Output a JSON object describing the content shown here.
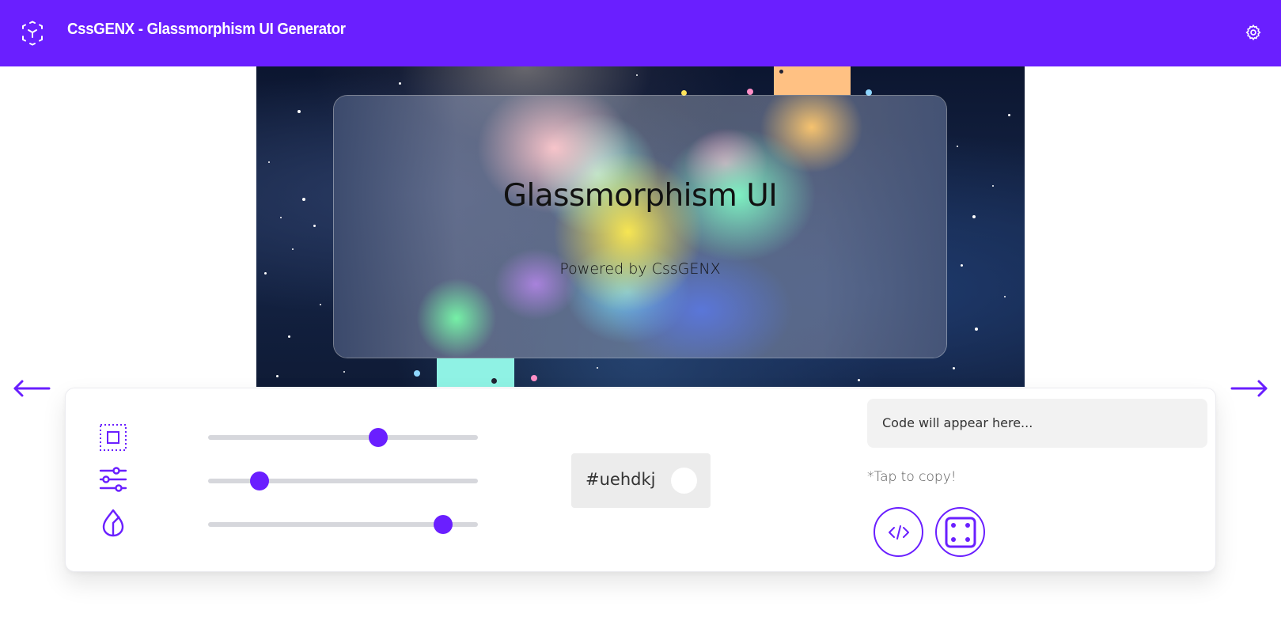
{
  "header": {
    "title": "CssGENX - Glassmorphism UI Generator",
    "logo_icon": "cube-logo-icon",
    "settings_icon": "gear-icon",
    "background": "#6a1fff"
  },
  "preview": {
    "card_title": "Glassmorphism UI",
    "card_subtitle": "Powered by CssGENX"
  },
  "navigation": {
    "prev_icon": "arrow-left-icon",
    "next_icon": "arrow-right-icon"
  },
  "controls": {
    "sliders": [
      {
        "name": "size",
        "icon": "frame-square-icon",
        "value": 0.63
      },
      {
        "name": "adjust",
        "icon": "sliders-icon",
        "value": 0.19
      },
      {
        "name": "blur",
        "icon": "drop-icon",
        "value": 0.87
      }
    ],
    "color": {
      "value": "#uehdkj",
      "swatch": "#ffffff"
    },
    "code": {
      "placeholder": "Code will appear here...",
      "copy_hint": "*Tap to copy!"
    },
    "buttons": [
      {
        "name": "code-button",
        "icon": "code-icon"
      },
      {
        "name": "randomize-button",
        "icon": "dice-icon"
      }
    ]
  },
  "colors": {
    "accent": "#6a1fff",
    "track": "#d6d7dc",
    "panel_bg": "#ffffff",
    "input_bg": "#f2f2f2"
  }
}
